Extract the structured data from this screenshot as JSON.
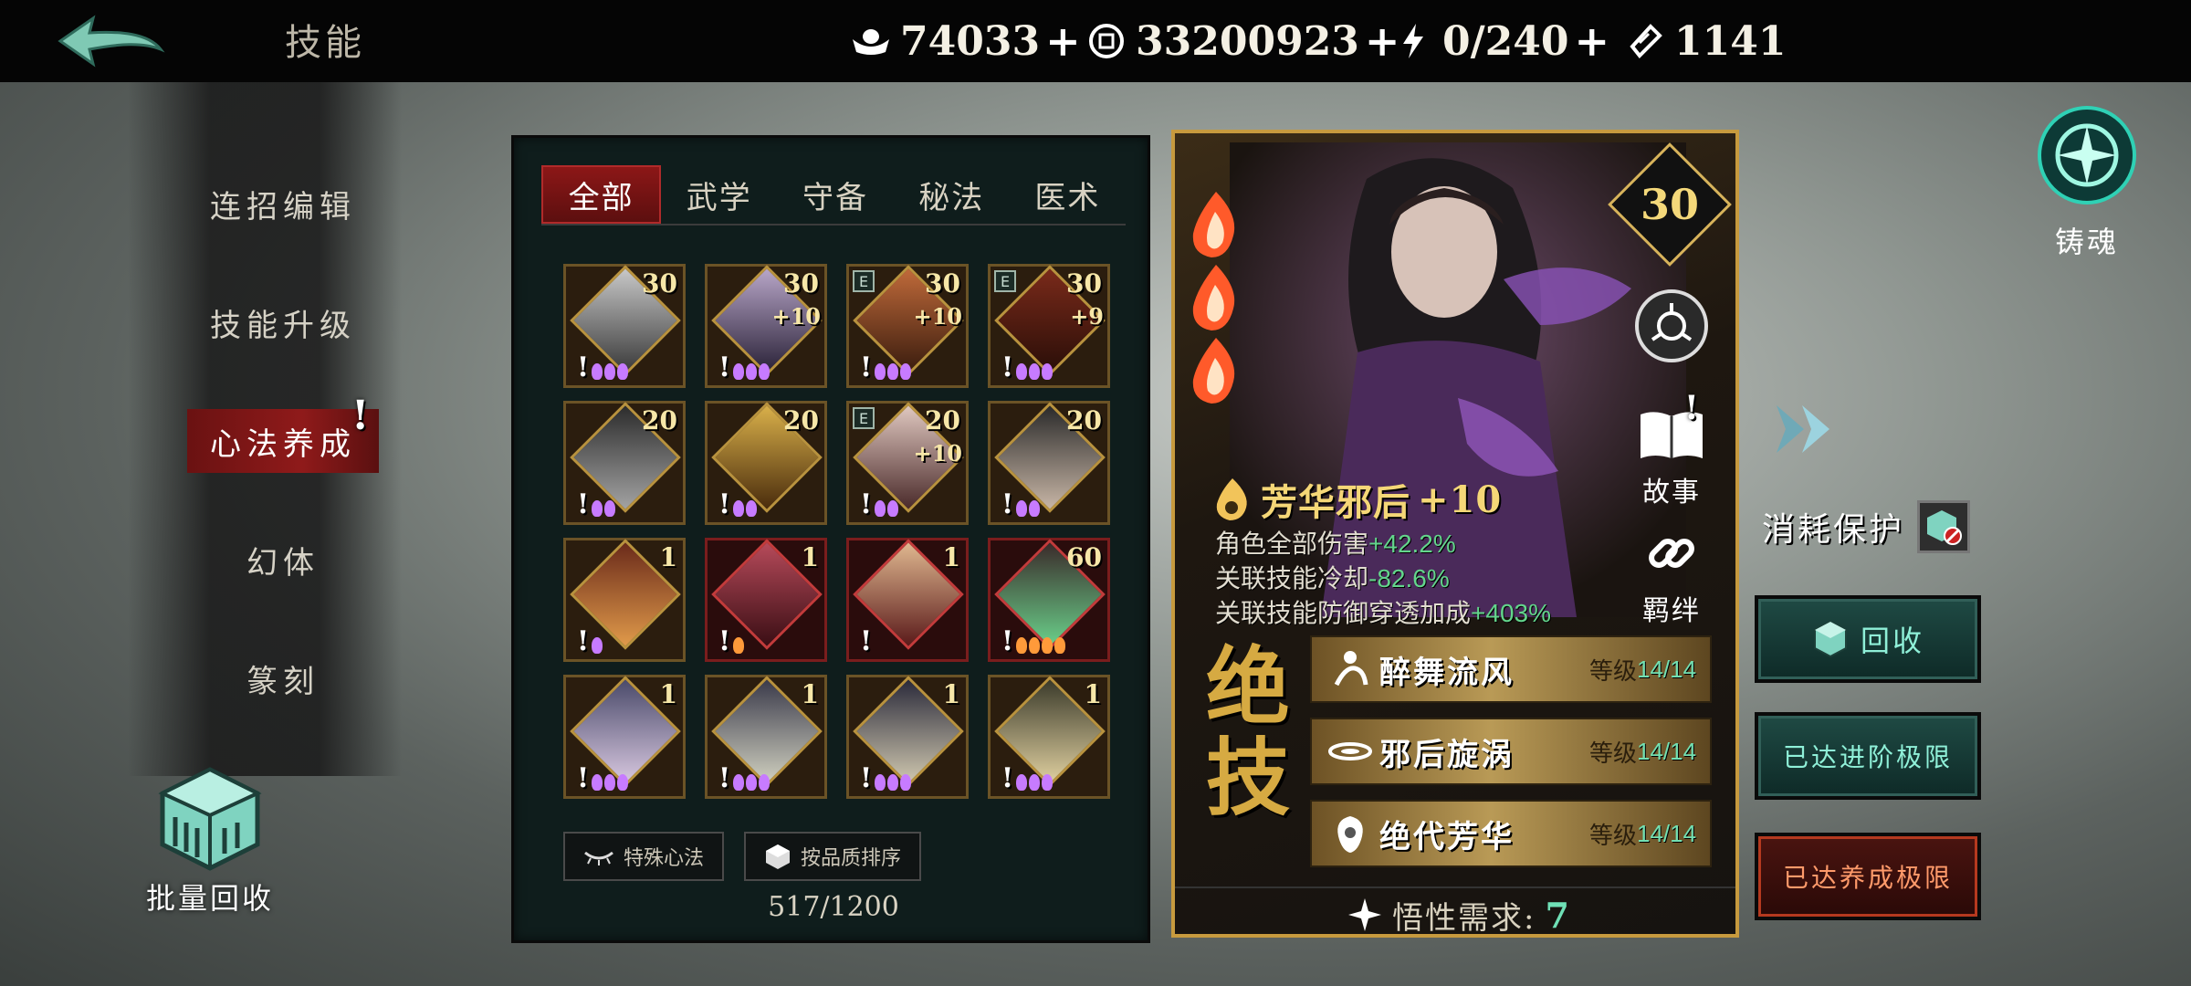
{
  "topbar": {
    "title": "技能",
    "resources": [
      {
        "icon": "silver-ingot-icon",
        "value": "74033"
      },
      {
        "icon": "coin-icon",
        "value": "33200923"
      },
      {
        "icon": "lightning-icon",
        "value": "0/240"
      },
      {
        "icon": "ticket-icon",
        "value": "1141"
      }
    ]
  },
  "menu": {
    "items": [
      "连招编辑",
      "技能升级",
      "心法养成",
      "幻体",
      "篆刻"
    ],
    "active_index": 2,
    "bulk_recycle_label": "批量回收"
  },
  "grid": {
    "tabs": [
      "全部",
      "武学",
      "守备",
      "秘法",
      "医术"
    ],
    "active_tab": 0,
    "cards": [
      {
        "level": "30",
        "bonus": "",
        "e": false,
        "red": false,
        "flames": 3
      },
      {
        "level": "30",
        "bonus": "+10",
        "e": false,
        "red": false,
        "flames": 3
      },
      {
        "level": "30",
        "bonus": "+10",
        "e": true,
        "red": false,
        "flames": 3
      },
      {
        "level": "30",
        "bonus": "+9",
        "e": true,
        "red": false,
        "flames": 3
      },
      {
        "level": "20",
        "bonus": "",
        "e": false,
        "red": false,
        "flames": 2
      },
      {
        "level": "20",
        "bonus": "",
        "e": false,
        "red": false,
        "flames": 2
      },
      {
        "level": "20",
        "bonus": "+10",
        "e": true,
        "red": false,
        "flames": 2
      },
      {
        "level": "20",
        "bonus": "",
        "e": false,
        "red": false,
        "flames": 2
      },
      {
        "level": "1",
        "bonus": "",
        "e": false,
        "red": false,
        "flames": 1
      },
      {
        "level": "1",
        "bonus": "",
        "e": false,
        "red": true,
        "flames": 1
      },
      {
        "level": "1",
        "bonus": "",
        "e": false,
        "red": true,
        "flames": 0
      },
      {
        "level": "60",
        "bonus": "",
        "e": false,
        "red": true,
        "flames": 4
      },
      {
        "level": "1",
        "bonus": "",
        "e": false,
        "red": false,
        "flames": 3
      },
      {
        "level": "1",
        "bonus": "",
        "e": false,
        "red": false,
        "flames": 3
      },
      {
        "level": "1",
        "bonus": "",
        "e": false,
        "red": false,
        "flames": 3
      },
      {
        "level": "1",
        "bonus": "",
        "e": false,
        "red": false,
        "flames": 3
      }
    ],
    "special_btn": "特殊心法",
    "sort_btn": "按品质排序",
    "capacity": "517/1200"
  },
  "detail": {
    "level": "30",
    "name": "芳华邪后",
    "name_bonus": "+10",
    "story_label": "故事",
    "bond_label": "羁绊",
    "stats": [
      {
        "label": "角色全部伤害",
        "value": "+42.2%"
      },
      {
        "label": "关联技能冷却",
        "value": "-82.6%"
      },
      {
        "label": "关联技能防御穿透加成",
        "value": "+403%"
      }
    ],
    "ult_chars": [
      "绝",
      "技"
    ],
    "skills": [
      {
        "name": "醉舞流风",
        "label": "等级",
        "level": "14/14"
      },
      {
        "name": "邪后旋涡",
        "label": "等级",
        "level": "14/14"
      },
      {
        "name": "绝代芳华",
        "label": "等级",
        "level": "14/14"
      }
    ],
    "insight_label": "悟性需求:",
    "insight_value": "7"
  },
  "right": {
    "forge_label": "铸魂",
    "protect_label": "消耗保护",
    "recycle_label": "回收",
    "advance_label": "已达进阶极限",
    "cultivate_label": "已达养成极限"
  },
  "colors": {
    "accent_red": "#8f1a1a",
    "gold": "#d7b35b",
    "good_green": "#63d58c",
    "teal": "#8ff0d8"
  }
}
